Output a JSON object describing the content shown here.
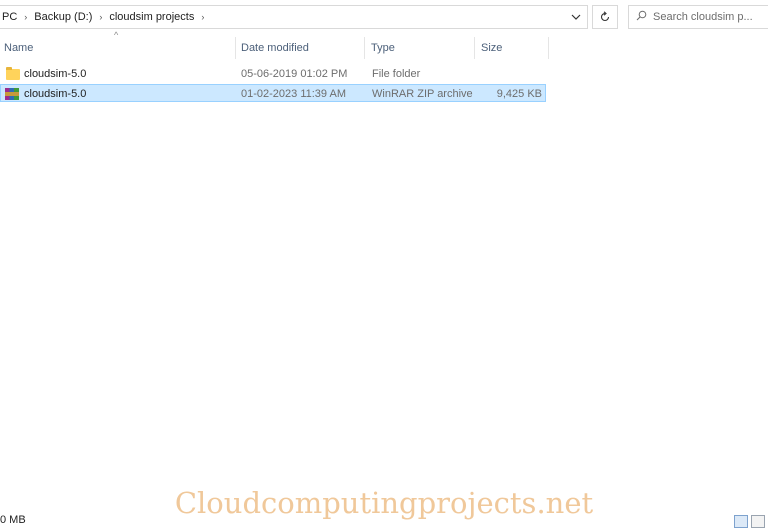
{
  "address": {
    "crumbs": [
      "PC",
      "Backup (D:)",
      "cloudsim projects"
    ],
    "separator": "›",
    "dropdown_icon": "chevron-down-icon",
    "refresh_icon": "refresh-icon"
  },
  "search": {
    "placeholder": "Search cloudsim p...",
    "icon": "search-icon"
  },
  "columns": {
    "name": "Name",
    "date": "Date modified",
    "type": "Type",
    "size": "Size"
  },
  "rows": [
    {
      "name": "cloudsim-5.0",
      "date": "05-06-2019 01:02 PM",
      "type": "File folder",
      "size": "",
      "icon": "folder-icon",
      "selected": false
    },
    {
      "name": "cloudsim-5.0",
      "date": "01-02-2023 11:39 AM",
      "type": "WinRAR ZIP archive",
      "size": "9,425 KB",
      "icon": "winrar-archive-icon",
      "selected": true
    }
  ],
  "status": {
    "size_text": "0 MB"
  },
  "watermark": "Cloudcomputingprojects.net",
  "colors": {
    "selection": "#cce8ff",
    "selection_border": "#99d1ff",
    "header_text": "#4c607a",
    "watermark": "#f0c89a"
  }
}
